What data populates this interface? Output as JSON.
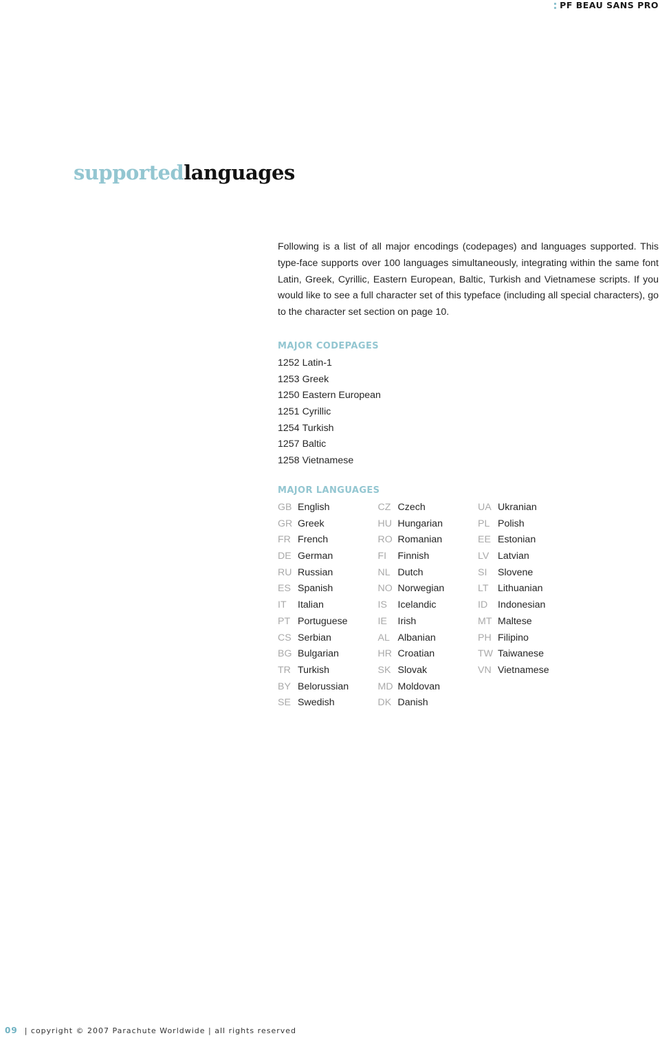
{
  "header": {
    "brand": "PF BEAU SANS PRO",
    "brand_icon": "colon-icon"
  },
  "title": {
    "accent": "supported",
    "main": "languages"
  },
  "intro": "Following is a list of all major encodings (codepages) and languages supported. This type-face supports over 100 languages simultaneously, integrating within the same font Latin, Greek, Cyrillic, Eastern European, Baltic, Turkish and Vietnamese scripts.  If you would like to see a full character set of this typeface (including all special characters), go to the character set section on page 10.",
  "codepages": {
    "heading": "MAJOR CODEPAGES",
    "items": [
      {
        "code": "1252",
        "name": "Latin-1"
      },
      {
        "code": "1253",
        "name": "Greek"
      },
      {
        "code": "1250",
        "name": "Eastern European"
      },
      {
        "code": "1251",
        "name": "Cyrillic"
      },
      {
        "code": "1254",
        "name": "Turkish"
      },
      {
        "code": "1257",
        "name": "Baltic"
      },
      {
        "code": "1258",
        "name": "Vietnamese"
      }
    ]
  },
  "languages": {
    "heading": "MAJOR LANGUAGES",
    "columns": [
      [
        {
          "code": "GB",
          "name": "English"
        },
        {
          "code": "GR",
          "name": "Greek"
        },
        {
          "code": "FR",
          "name": "French"
        },
        {
          "code": "DE",
          "name": "German"
        },
        {
          "code": "RU",
          "name": "Russian"
        },
        {
          "code": "ES",
          "name": "Spanish"
        },
        {
          "code": "IT",
          "name": "Italian"
        },
        {
          "code": "PT",
          "name": "Portuguese"
        },
        {
          "code": "CS",
          "name": "Serbian"
        },
        {
          "code": "BG",
          "name": "Bulgarian"
        },
        {
          "code": "TR",
          "name": "Turkish"
        },
        {
          "code": "BY",
          "name": "Belorussian"
        },
        {
          "code": "SE",
          "name": "Swedish"
        }
      ],
      [
        {
          "code": "CZ",
          "name": "Czech"
        },
        {
          "code": "HU",
          "name": "Hungarian"
        },
        {
          "code": "RO",
          "name": "Romanian"
        },
        {
          "code": "FI",
          "name": "Finnish"
        },
        {
          "code": "NL",
          "name": "Dutch"
        },
        {
          "code": "NO",
          "name": "Norwegian"
        },
        {
          "code": "IS",
          "name": "Icelandic"
        },
        {
          "code": "IE",
          "name": "Irish"
        },
        {
          "code": "AL",
          "name": "Albanian"
        },
        {
          "code": "HR",
          "name": "Croatian"
        },
        {
          "code": "SK",
          "name": "Slovak"
        },
        {
          "code": "MD",
          "name": "Moldovan"
        },
        {
          "code": "DK",
          "name": "Danish"
        }
      ],
      [
        {
          "code": "UA",
          "name": "Ukranian"
        },
        {
          "code": "PL",
          "name": "Polish"
        },
        {
          "code": "EE",
          "name": "Estonian"
        },
        {
          "code": "LV",
          "name": "Latvian"
        },
        {
          "code": "SI",
          "name": "Slovene"
        },
        {
          "code": "LT",
          "name": "Lithuanian"
        },
        {
          "code": "ID",
          "name": "Indonesian"
        },
        {
          "code": "MT",
          "name": "Maltese"
        },
        {
          "code": "PH",
          "name": "Filipino"
        },
        {
          "code": "TW",
          "name": "Taiwanese"
        },
        {
          "code": "VN",
          "name": "Vietnamese"
        }
      ]
    ]
  },
  "footer": {
    "page_number": "09",
    "text": "| copyright © 2007 Parachute Worldwide | all rights reserved"
  },
  "colors": {
    "accent": "#93c6d1",
    "text": "#262626",
    "code_gray": "#a9a9a9"
  }
}
